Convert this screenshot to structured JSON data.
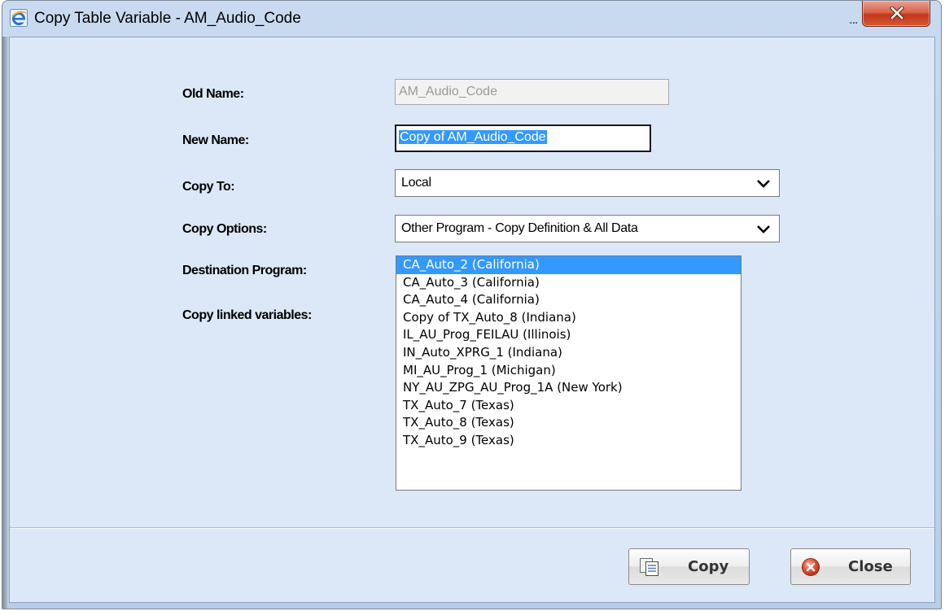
{
  "window": {
    "title": "Copy Table Variable - AM_Audio_Code",
    "title_overflow": "...",
    "icon": "ie-browser-icon",
    "close_icon": "close-x-icon"
  },
  "form": {
    "old_name": {
      "label": "Old Name:",
      "value": "AM_Audio_Code",
      "enabled": false
    },
    "new_name": {
      "label": "New Name:",
      "value": "Copy of AM_Audio_Code",
      "text_selected": true
    },
    "copy_to": {
      "label": "Copy To:",
      "value": "Local"
    },
    "copy_options": {
      "label": "Copy Options:",
      "value": "Other Program - Copy Definition & All Data"
    },
    "destination_program": {
      "label": "Destination Program:",
      "selected_index": 0,
      "options": [
        "CA_Auto_2 (California)",
        "CA_Auto_3 (California)",
        "CA_Auto_4 (California)",
        "Copy of TX_Auto_8 (Indiana)",
        "IL_AU_Prog_FEILAU (Illinois)",
        "IN_Auto_XPRG_1 (Indiana)",
        "MI_AU_Prog_1 (Michigan)",
        "NY_AU_ZPG_AU_Prog_1A (New York)",
        "TX_Auto_7 (Texas)",
        "TX_Auto_8 (Texas)",
        "TX_Auto_9 (Texas)"
      ]
    },
    "copy_linked_variables": {
      "label": "Copy linked variables:"
    }
  },
  "buttons": {
    "copy": {
      "label": "Copy",
      "icon": "copy-pages-icon"
    },
    "close": {
      "label": "Close",
      "icon": "close-circle-icon"
    }
  },
  "colors": {
    "selection": "#3399ff",
    "client_bg": "#dce8f7",
    "close_button": "#c3381b"
  }
}
